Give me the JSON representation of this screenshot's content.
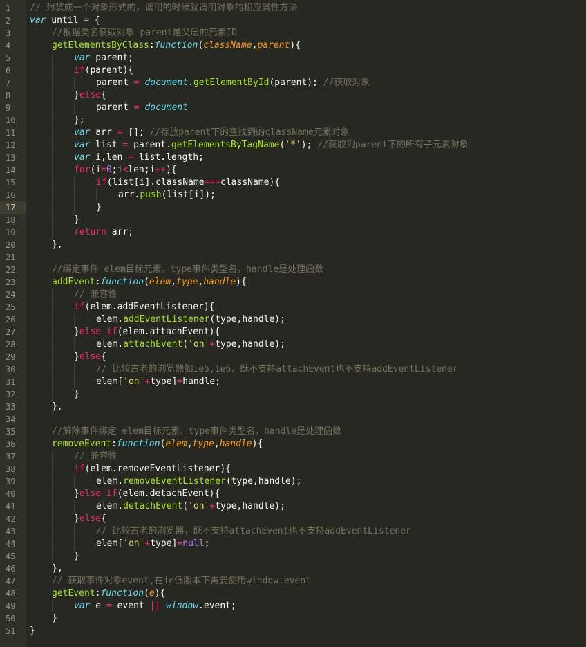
{
  "editor": {
    "current_line": 17,
    "colors": {
      "background": "#272822",
      "gutter": "#2f3129",
      "comment": "#75715e",
      "keyword": "#f92672",
      "function": "#a6e22e",
      "parameter": "#fd971f",
      "string": "#e6db74",
      "number": "#ae81ff",
      "builtin": "#66d9ef"
    },
    "lines": [
      {
        "n": "1",
        "indent": 0,
        "tokens": [
          [
            "comment",
            "// 封装成一个对象形式的，调用的时候就调用对象的相应属性方法"
          ]
        ]
      },
      {
        "n": "2",
        "indent": 0,
        "tokens": [
          [
            "storage",
            "var"
          ],
          [
            "plain",
            " until = {"
          ]
        ]
      },
      {
        "n": "3",
        "indent": 1,
        "tokens": [
          [
            "comment",
            "//根据类名获取对象 parent是父层的元素ID"
          ]
        ]
      },
      {
        "n": "4",
        "indent": 1,
        "tokens": [
          [
            "func",
            "getElementsByClass"
          ],
          [
            "plain",
            ":"
          ],
          [
            "storage",
            "function"
          ],
          [
            "plain",
            "("
          ],
          [
            "param",
            "className"
          ],
          [
            "plain",
            ","
          ],
          [
            "param",
            "parent"
          ],
          [
            "plain",
            "){"
          ]
        ]
      },
      {
        "n": "5",
        "indent": 2,
        "tokens": [
          [
            "storage",
            "var"
          ],
          [
            "plain",
            " parent;"
          ]
        ]
      },
      {
        "n": "6",
        "indent": 2,
        "tokens": [
          [
            "keyword",
            "if"
          ],
          [
            "plain",
            "(parent){"
          ]
        ]
      },
      {
        "n": "7",
        "indent": 3,
        "tokens": [
          [
            "plain",
            "parent "
          ],
          [
            "keyword",
            "="
          ],
          [
            "plain",
            " "
          ],
          [
            "builtin",
            "document"
          ],
          [
            "plain",
            "."
          ],
          [
            "func",
            "getElementById"
          ],
          [
            "plain",
            "(parent); "
          ],
          [
            "comment",
            "//获取对象"
          ]
        ]
      },
      {
        "n": "8",
        "indent": 2,
        "tokens": [
          [
            "plain",
            "}"
          ],
          [
            "keyword",
            "else"
          ],
          [
            "plain",
            "{"
          ]
        ]
      },
      {
        "n": "9",
        "indent": 3,
        "tokens": [
          [
            "plain",
            "parent "
          ],
          [
            "keyword",
            "="
          ],
          [
            "plain",
            " "
          ],
          [
            "builtin",
            "document"
          ]
        ]
      },
      {
        "n": "10",
        "indent": 2,
        "tokens": [
          [
            "plain",
            "};"
          ]
        ]
      },
      {
        "n": "11",
        "indent": 2,
        "tokens": [
          [
            "storage",
            "var"
          ],
          [
            "plain",
            " arr "
          ],
          [
            "keyword",
            "="
          ],
          [
            "plain",
            " []; "
          ],
          [
            "comment",
            "//存放parent下的查找到的className元素对象"
          ]
        ]
      },
      {
        "n": "12",
        "indent": 2,
        "tokens": [
          [
            "storage",
            "var"
          ],
          [
            "plain",
            " list "
          ],
          [
            "keyword",
            "="
          ],
          [
            "plain",
            " parent."
          ],
          [
            "func",
            "getElementsByTagName"
          ],
          [
            "plain",
            "("
          ],
          [
            "string",
            "'*'"
          ],
          [
            "plain",
            "); "
          ],
          [
            "comment",
            "//获取到parent下的所有子元素对象"
          ]
        ]
      },
      {
        "n": "13",
        "indent": 2,
        "tokens": [
          [
            "storage",
            "var"
          ],
          [
            "plain",
            " i,len "
          ],
          [
            "keyword",
            "="
          ],
          [
            "plain",
            " list.length;"
          ]
        ]
      },
      {
        "n": "14",
        "indent": 2,
        "tokens": [
          [
            "keyword",
            "for"
          ],
          [
            "plain",
            "(i"
          ],
          [
            "keyword",
            "="
          ],
          [
            "number",
            "0"
          ],
          [
            "plain",
            ";i"
          ],
          [
            "keyword",
            "<"
          ],
          [
            "plain",
            "len;i"
          ],
          [
            "keyword",
            "++"
          ],
          [
            "plain",
            "){"
          ]
        ]
      },
      {
        "n": "15",
        "indent": 3,
        "tokens": [
          [
            "keyword",
            "if"
          ],
          [
            "plain",
            "(list[i].className"
          ],
          [
            "keyword",
            "==="
          ],
          [
            "plain",
            "className){"
          ]
        ]
      },
      {
        "n": "16",
        "indent": 4,
        "tokens": [
          [
            "plain",
            "arr."
          ],
          [
            "func",
            "push"
          ],
          [
            "plain",
            "(list[i]);"
          ]
        ]
      },
      {
        "n": "17",
        "indent": 3,
        "tokens": [
          [
            "plain",
            "}"
          ]
        ]
      },
      {
        "n": "18",
        "indent": 2,
        "tokens": [
          [
            "plain",
            "}"
          ]
        ]
      },
      {
        "n": "19",
        "indent": 2,
        "tokens": [
          [
            "keyword",
            "return"
          ],
          [
            "plain",
            " arr;"
          ]
        ]
      },
      {
        "n": "20",
        "indent": 1,
        "tokens": [
          [
            "plain",
            "},"
          ]
        ]
      },
      {
        "n": "21",
        "indent": 0,
        "tokens": []
      },
      {
        "n": "22",
        "indent": 1,
        "tokens": [
          [
            "comment",
            "//绑定事件 elem目标元素，type事件类型名，handle是处理函数"
          ]
        ]
      },
      {
        "n": "23",
        "indent": 1,
        "tokens": [
          [
            "func",
            "addEvent"
          ],
          [
            "plain",
            ":"
          ],
          [
            "storage",
            "function"
          ],
          [
            "plain",
            "("
          ],
          [
            "param",
            "elem"
          ],
          [
            "plain",
            ","
          ],
          [
            "param",
            "type"
          ],
          [
            "plain",
            ","
          ],
          [
            "param",
            "handle"
          ],
          [
            "plain",
            "){"
          ]
        ]
      },
      {
        "n": "24",
        "indent": 2,
        "tokens": [
          [
            "comment",
            "// 兼容性"
          ]
        ]
      },
      {
        "n": "25",
        "indent": 2,
        "tokens": [
          [
            "keyword",
            "if"
          ],
          [
            "plain",
            "(elem.addEventListener){"
          ]
        ]
      },
      {
        "n": "26",
        "indent": 3,
        "tokens": [
          [
            "plain",
            "elem."
          ],
          [
            "func",
            "addEventListener"
          ],
          [
            "plain",
            "(type,handle);"
          ]
        ]
      },
      {
        "n": "27",
        "indent": 2,
        "tokens": [
          [
            "plain",
            "}"
          ],
          [
            "keyword",
            "else"
          ],
          [
            "plain",
            " "
          ],
          [
            "keyword",
            "if"
          ],
          [
            "plain",
            "(elem.attachEvent){"
          ]
        ]
      },
      {
        "n": "28",
        "indent": 3,
        "tokens": [
          [
            "plain",
            "elem."
          ],
          [
            "func",
            "attachEvent"
          ],
          [
            "plain",
            "("
          ],
          [
            "string",
            "'on'"
          ],
          [
            "keyword",
            "+"
          ],
          [
            "plain",
            "type,handle);"
          ]
        ]
      },
      {
        "n": "29",
        "indent": 2,
        "tokens": [
          [
            "plain",
            "}"
          ],
          [
            "keyword",
            "else"
          ],
          [
            "plain",
            "{"
          ]
        ]
      },
      {
        "n": "30",
        "indent": 3,
        "tokens": [
          [
            "comment",
            "// 比较古老的浏览器如ie5,ie6，既不支持attachEvent也不支持addEventListener"
          ]
        ]
      },
      {
        "n": "31",
        "indent": 3,
        "tokens": [
          [
            "plain",
            "elem["
          ],
          [
            "string",
            "'on'"
          ],
          [
            "keyword",
            "+"
          ],
          [
            "plain",
            "type]"
          ],
          [
            "keyword",
            "="
          ],
          [
            "plain",
            "handle;"
          ]
        ]
      },
      {
        "n": "32",
        "indent": 2,
        "tokens": [
          [
            "plain",
            "}"
          ]
        ]
      },
      {
        "n": "33",
        "indent": 1,
        "tokens": [
          [
            "plain",
            "},"
          ]
        ]
      },
      {
        "n": "34",
        "indent": 0,
        "tokens": []
      },
      {
        "n": "35",
        "indent": 1,
        "tokens": [
          [
            "comment",
            "//解除事件绑定 elem目标元素，type事件类型名，handle是处理函数"
          ]
        ]
      },
      {
        "n": "36",
        "indent": 1,
        "tokens": [
          [
            "func",
            "removeEvent"
          ],
          [
            "plain",
            ":"
          ],
          [
            "storage",
            "function"
          ],
          [
            "plain",
            "("
          ],
          [
            "param",
            "elem"
          ],
          [
            "plain",
            ","
          ],
          [
            "param",
            "type"
          ],
          [
            "plain",
            ","
          ],
          [
            "param",
            "handle"
          ],
          [
            "plain",
            "){"
          ]
        ]
      },
      {
        "n": "37",
        "indent": 2,
        "tokens": [
          [
            "comment",
            "// 兼容性"
          ]
        ]
      },
      {
        "n": "38",
        "indent": 2,
        "tokens": [
          [
            "keyword",
            "if"
          ],
          [
            "plain",
            "(elem.removeEventListener){"
          ]
        ]
      },
      {
        "n": "39",
        "indent": 3,
        "tokens": [
          [
            "plain",
            "elem."
          ],
          [
            "func",
            "removeEventListener"
          ],
          [
            "plain",
            "(type,handle);"
          ]
        ]
      },
      {
        "n": "40",
        "indent": 2,
        "tokens": [
          [
            "plain",
            "}"
          ],
          [
            "keyword",
            "else"
          ],
          [
            "plain",
            " "
          ],
          [
            "keyword",
            "if"
          ],
          [
            "plain",
            "(elem.detachEvent){"
          ]
        ]
      },
      {
        "n": "41",
        "indent": 3,
        "tokens": [
          [
            "plain",
            "elem."
          ],
          [
            "func",
            "detachEvent"
          ],
          [
            "plain",
            "("
          ],
          [
            "string",
            "'on'"
          ],
          [
            "keyword",
            "+"
          ],
          [
            "plain",
            "type,handle);"
          ]
        ]
      },
      {
        "n": "42",
        "indent": 2,
        "tokens": [
          [
            "plain",
            "}"
          ],
          [
            "keyword",
            "else"
          ],
          [
            "plain",
            "{"
          ]
        ]
      },
      {
        "n": "43",
        "indent": 3,
        "tokens": [
          [
            "comment",
            "// 比较古老的浏览器，既不支持attachEvent也不支持addEventListener"
          ]
        ]
      },
      {
        "n": "44",
        "indent": 3,
        "tokens": [
          [
            "plain",
            "elem["
          ],
          [
            "string",
            "'on'"
          ],
          [
            "keyword",
            "+"
          ],
          [
            "plain",
            "type]"
          ],
          [
            "keyword",
            "="
          ],
          [
            "const",
            "null"
          ],
          [
            "plain",
            ";"
          ]
        ]
      },
      {
        "n": "45",
        "indent": 2,
        "tokens": [
          [
            "plain",
            "}"
          ]
        ]
      },
      {
        "n": "46",
        "indent": 1,
        "tokens": [
          [
            "plain",
            "},"
          ]
        ]
      },
      {
        "n": "47",
        "indent": 1,
        "tokens": [
          [
            "comment",
            "// 获取事件对象event,在ie低版本下需要使用window.event"
          ]
        ]
      },
      {
        "n": "48",
        "indent": 1,
        "tokens": [
          [
            "func",
            "getEvent"
          ],
          [
            "plain",
            ":"
          ],
          [
            "storage",
            "function"
          ],
          [
            "plain",
            "("
          ],
          [
            "param",
            "e"
          ],
          [
            "plain",
            "){"
          ]
        ]
      },
      {
        "n": "49",
        "indent": 2,
        "tokens": [
          [
            "storage",
            "var"
          ],
          [
            "plain",
            " e "
          ],
          [
            "keyword",
            "="
          ],
          [
            "plain",
            " event "
          ],
          [
            "keyword",
            "||"
          ],
          [
            "plain",
            " "
          ],
          [
            "builtin",
            "window"
          ],
          [
            "plain",
            ".event;"
          ]
        ]
      },
      {
        "n": "50",
        "indent": 1,
        "tokens": [
          [
            "plain",
            "}"
          ]
        ]
      },
      {
        "n": "51",
        "indent": 0,
        "tokens": [
          [
            "plain",
            "}"
          ]
        ]
      }
    ]
  }
}
